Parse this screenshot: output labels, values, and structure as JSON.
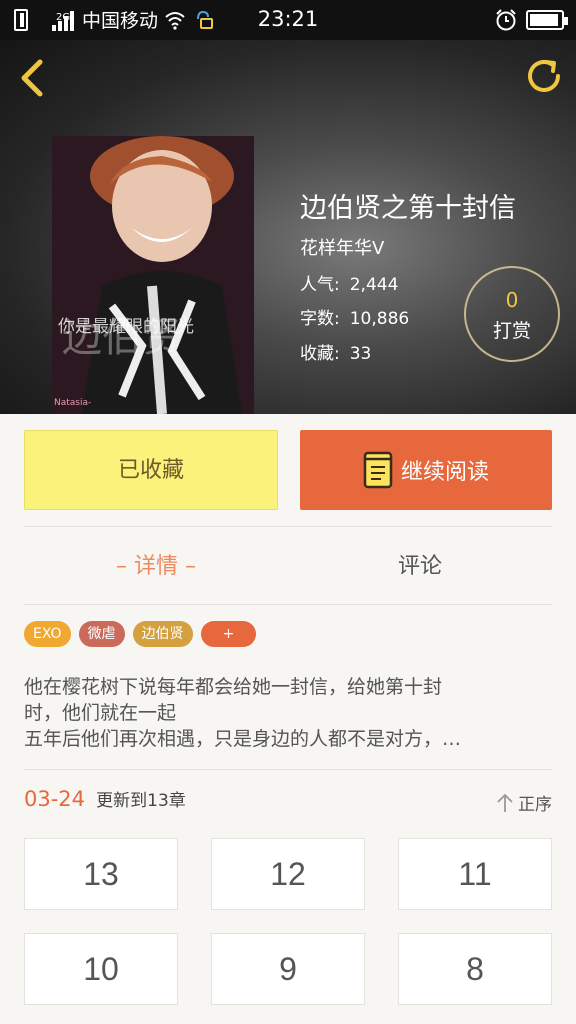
{
  "status_bar": {
    "network": "2G",
    "carrier": "中国移动",
    "time": "23:21"
  },
  "book": {
    "title": "边伯贤之第十封信",
    "author": "花样年华V",
    "cover_caption": "你是最耀眼的阳光",
    "cover_signature": "Natasia-",
    "stats": [
      {
        "label": "人气:",
        "value": "2,444"
      },
      {
        "label": "字数:",
        "value": "10,886"
      },
      {
        "label": "收藏:",
        "value": "33"
      }
    ],
    "tip": {
      "count": "0",
      "label": "打赏"
    }
  },
  "actions": {
    "favorite_label": "已收藏",
    "read_label": "继续阅读"
  },
  "tabs": [
    {
      "label": "– 详情 –",
      "active": true
    },
    {
      "label": "评论",
      "active": false
    }
  ],
  "tags": [
    {
      "label": "EXO",
      "color": "#f0a830"
    },
    {
      "label": "微虐",
      "color": "#c96a5a"
    },
    {
      "label": "边伯贤",
      "color": "#d4a040"
    },
    {
      "label": "+",
      "color": "#e6683c"
    }
  ],
  "description": [
    "他在樱花树下说每年都会给她一封信，给她第十封",
    "时，他们就在一起",
    "五年后他们再次相遇，只是身边的人都不是对方，…"
  ],
  "update": {
    "date": "03-24",
    "text": "更新到13章",
    "sort_label": "正序"
  },
  "chapters": [
    "13",
    "12",
    "11",
    "10",
    "9",
    "8"
  ],
  "colors": {
    "accent": "#e6683c",
    "favorite": "#fbf27b",
    "tab_active": "#ec8a5e"
  }
}
